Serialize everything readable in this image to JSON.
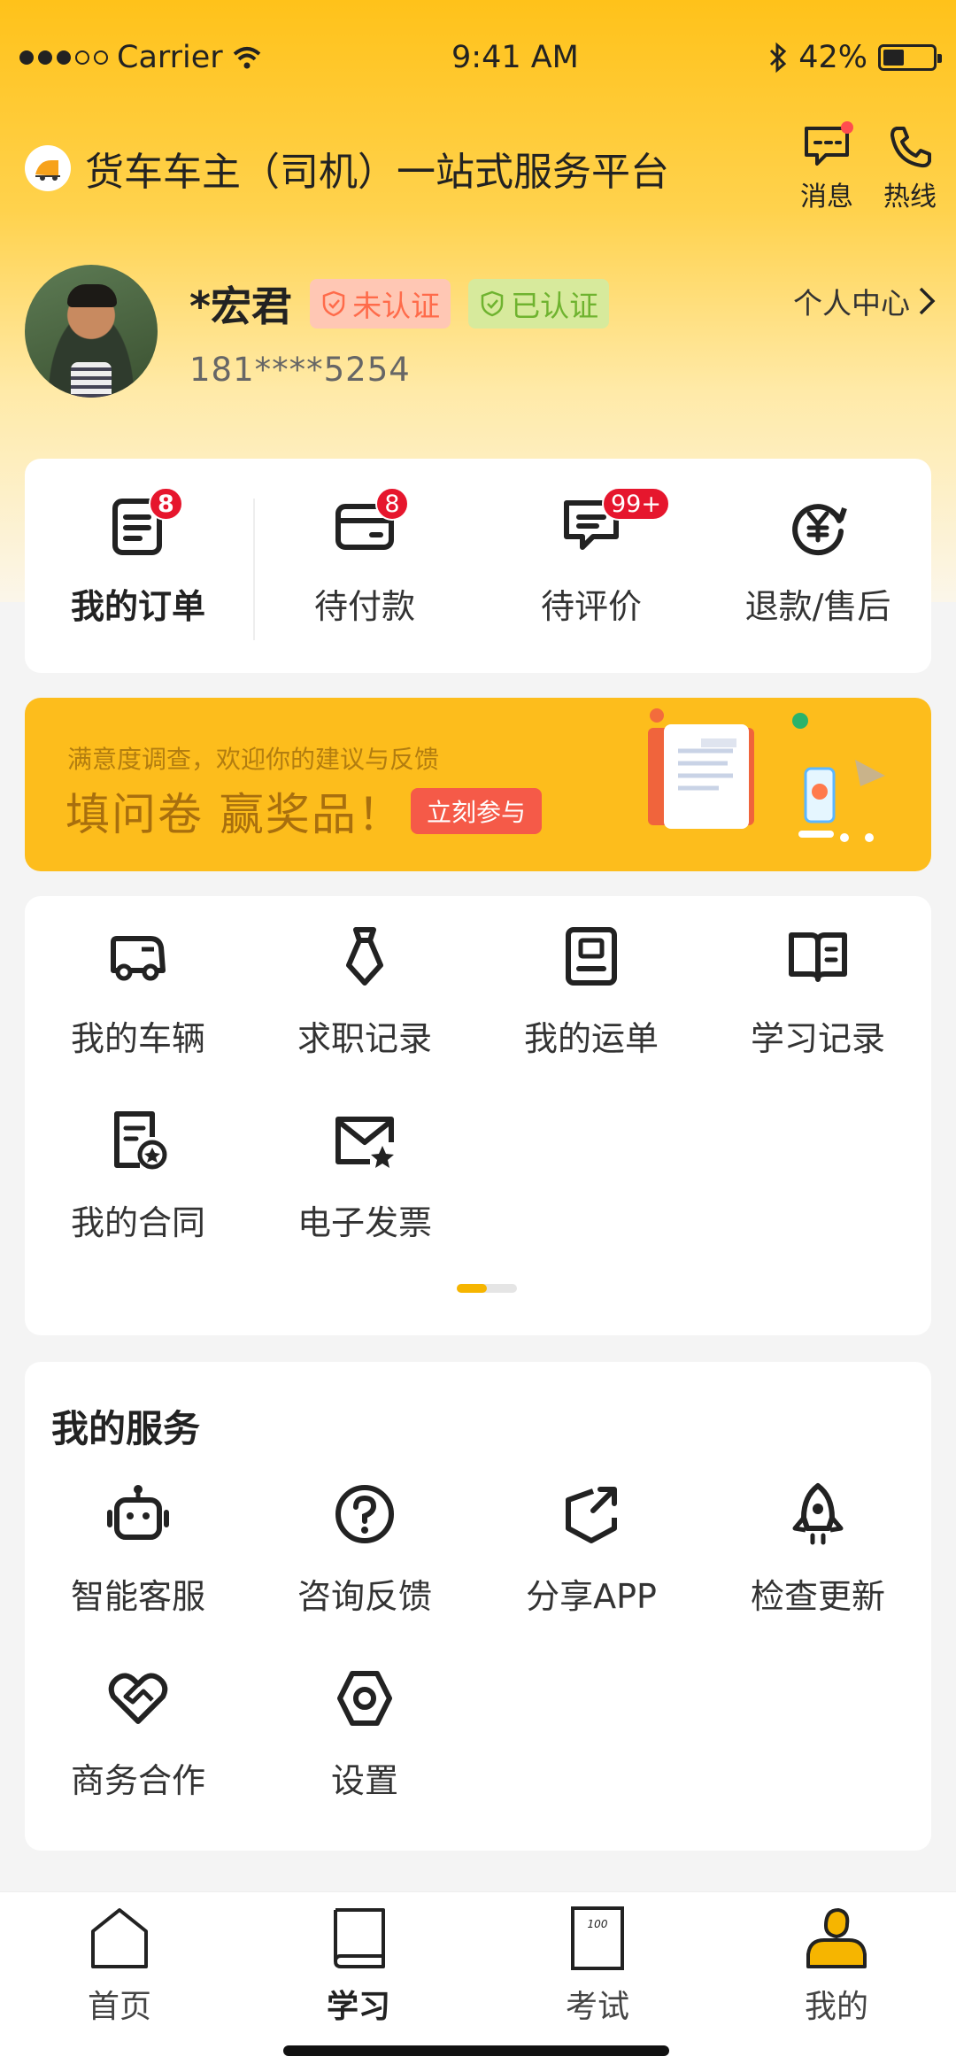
{
  "status_bar": {
    "carrier": "Carrier",
    "time": "9:41 AM",
    "battery": "42%",
    "battery_level": 0.42
  },
  "header": {
    "title": "货车车主（司机）一站式服务平台",
    "messages_label": "消息",
    "hotline_label": "热线"
  },
  "profile": {
    "name": "*宏君",
    "badge_unverified": "未认证",
    "badge_verified": "已认证",
    "phone": "181****5254",
    "personal_center": "个人中心"
  },
  "orders": {
    "items": [
      {
        "label": "我的订单",
        "badge": "8",
        "icon": "order-list-icon"
      },
      {
        "label": "待付款",
        "badge": "8",
        "icon": "wallet-icon"
      },
      {
        "label": "待评价",
        "badge": "99+",
        "icon": "review-icon"
      },
      {
        "label": "退款/售后",
        "badge": "",
        "icon": "refund-icon"
      }
    ]
  },
  "banner": {
    "subtitle": "满意度调查，欢迎你的建议与反馈",
    "title": "填问卷  赢奖品！",
    "button": "立刻参与"
  },
  "tools": {
    "items": [
      {
        "label": "我的车辆",
        "icon": "truck-icon"
      },
      {
        "label": "求职记录",
        "icon": "tie-icon"
      },
      {
        "label": "我的运单",
        "icon": "waybill-icon"
      },
      {
        "label": "学习记录",
        "icon": "book-open-icon"
      },
      {
        "label": "我的合同",
        "icon": "contract-icon"
      },
      {
        "label": "电子发票",
        "icon": "invoice-mail-icon"
      }
    ],
    "page_index": 1,
    "page_count": 2
  },
  "services": {
    "title": "我的服务",
    "items": [
      {
        "label": "智能客服",
        "icon": "robot-icon"
      },
      {
        "label": "咨询反馈",
        "icon": "question-icon"
      },
      {
        "label": "分享APP",
        "icon": "share-icon"
      },
      {
        "label": "检查更新",
        "icon": "rocket-icon"
      },
      {
        "label": "商务合作",
        "icon": "handshake-icon"
      },
      {
        "label": "设置",
        "icon": "settings-icon"
      }
    ]
  },
  "tabbar": {
    "items": [
      {
        "label": "首页",
        "icon": "home-icon"
      },
      {
        "label": "学习",
        "icon": "study-book-icon"
      },
      {
        "label": "考试",
        "icon": "exam-icon"
      },
      {
        "label": "我的",
        "icon": "profile-icon",
        "active": true
      }
    ]
  },
  "colors": {
    "brand_yellow": "#ffc21a",
    "badge_red": "#e6162d",
    "active_tab": "#f6b500"
  }
}
